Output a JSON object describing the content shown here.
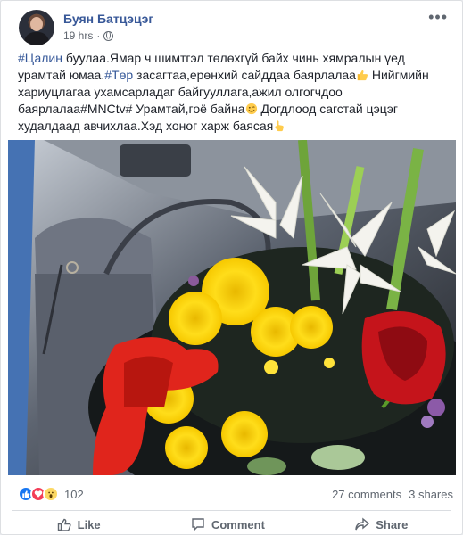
{
  "post": {
    "author": "Буян Батцэцэг",
    "timestamp": "19 hrs",
    "separator": "·",
    "privacy_icon": "globe-icon",
    "more_label": "•••",
    "text": {
      "h1": "#Цалин",
      "s1": " буулаа.Ямар ч шимтгэл төлөхгүй байх чинь хямралын үед урамтай юмаа.",
      "h2": "#Төр",
      "s2": " засагтаа,ерөнхий сайддаа баярлалаа",
      "s3": " Нийгмийн хариуцлагаа ухамсарладаг байгууллага,ажил олгогчдоо баярлалаа#MNCtv# Урамтай,гоё байна",
      "s4": " Догдлоод сагстай цэцэг худалдаад авчихлаа.Хэд хоног харж баясая"
    },
    "emojis": [
      "thumbs-up-icon",
      "smiley-icon",
      "pointing-hand-icon"
    ]
  },
  "engagement": {
    "reaction_icons": [
      "like-icon",
      "love-icon",
      "wow-icon"
    ],
    "reaction_count": "102",
    "comments": "27 comments",
    "shares": "3 shares"
  },
  "actions": {
    "like": "Like",
    "comment": "Comment",
    "share": "Share"
  },
  "colors": {
    "link": "#385898",
    "hashtag": "#365899",
    "like_blue": "#1877f2",
    "love_red": "#f33e58",
    "wow_yellow": "#fcd864"
  }
}
